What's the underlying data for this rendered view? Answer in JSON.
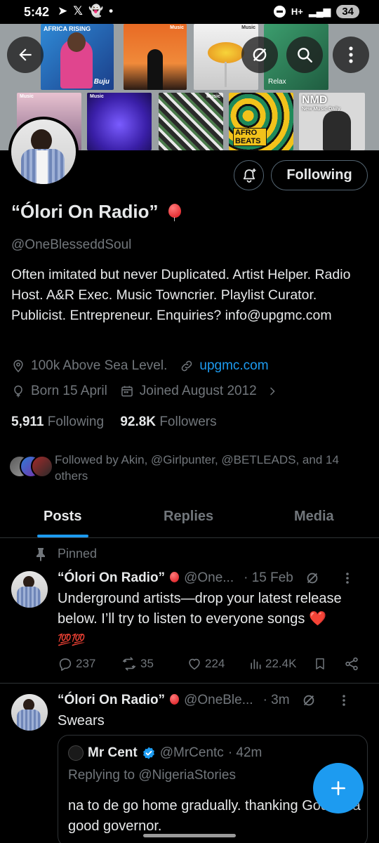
{
  "status_bar": {
    "time": "5:42",
    "battery": "34",
    "network": "H+"
  },
  "banner": {
    "tiles": [
      {
        "label": "AFRICA RISING",
        "sub": "Buju"
      },
      {
        "label": "Music"
      },
      {
        "label": "Music"
      },
      {
        "label": "Relax"
      },
      {
        "label": "Music"
      },
      {
        "label": "Music"
      },
      {
        "label": "Music"
      },
      {
        "label": "AFRO BEATS"
      },
      {
        "label": "NMD",
        "sub": "New Music Daily"
      }
    ]
  },
  "profile": {
    "follow_button": "Following",
    "display_name": "“Ólori On Radio”",
    "handle": "@OneBlesseddSoul",
    "bio": "Often imitated but never Duplicated. Artist Helper. Radio Host. A&R Exec. Music Towncrier. Playlist Curator. Publicist. Entrepreneur. Enquiries? info@upgmc.com",
    "location": "100k Above Sea Level.",
    "website": "upgmc.com",
    "birthday": "Born 15 April",
    "joined": "Joined August 2012",
    "following_count": "5,911",
    "following_label": "Following",
    "followers_count": "92.8K",
    "followers_label": "Followers",
    "followed_by": "Followed by Akin, @Girlpunter, @BETLEADS, and 14 others"
  },
  "tabs": [
    {
      "label": "Posts",
      "active": true
    },
    {
      "label": "Replies",
      "active": false
    },
    {
      "label": "Media",
      "active": false
    }
  ],
  "tweets": [
    {
      "pinned_label": "Pinned",
      "name": "“Ólori On Radio”",
      "handle": "@One...",
      "time": "· 15 Feb",
      "text": "Underground artists—drop your latest release below. I’ll try to listen to everyone songs ❤️",
      "emoji_line": "💯💯",
      "replies": "237",
      "reposts": "35",
      "likes": "224",
      "views": "22.4K"
    },
    {
      "name": "“Ólori On Radio”",
      "handle": "@OneBle...",
      "time": "· 3m",
      "text": "Swears",
      "quote": {
        "name": "Mr Cent",
        "handle": "@MrCentc",
        "time": "· 42m",
        "replying_to": "Replying to @NigeriaStories",
        "text": "na to de go home gradually. thanking God for a good governor."
      }
    }
  ],
  "colors": {
    "accent": "#1d9bf0",
    "muted": "#71767b",
    "text": "#e7e9ea",
    "background": "#000000",
    "like_heart": "#f91880"
  }
}
